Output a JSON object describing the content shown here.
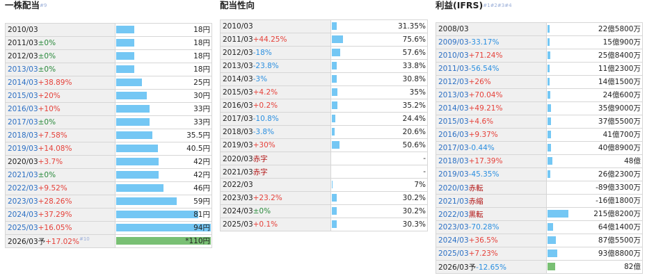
{
  "panels": [
    {
      "title": "一株配当",
      "note": "#9",
      "rows": [
        {
          "year": "2010/03",
          "link": false,
          "change": "",
          "cls": "",
          "value": "18円",
          "bar": 0.19
        },
        {
          "year": "2011/03",
          "link": false,
          "change": "±0%",
          "cls": "zero",
          "value": "18円",
          "bar": 0.19
        },
        {
          "year": "2012/03",
          "link": false,
          "change": "±0%",
          "cls": "zero",
          "value": "18円",
          "bar": 0.19
        },
        {
          "year": "2013/03",
          "link": true,
          "change": "±0%",
          "cls": "zero",
          "value": "18円",
          "bar": 0.19
        },
        {
          "year": "2014/03",
          "link": true,
          "change": "+38.89%",
          "cls": "pos",
          "value": "25円",
          "bar": 0.27
        },
        {
          "year": "2015/03",
          "link": true,
          "change": "+20%",
          "cls": "pos",
          "value": "30円",
          "bar": 0.32
        },
        {
          "year": "2016/03",
          "link": true,
          "change": "+10%",
          "cls": "pos",
          "value": "33円",
          "bar": 0.35
        },
        {
          "year": "2017/03",
          "link": true,
          "change": "±0%",
          "cls": "zero",
          "value": "33円",
          "bar": 0.35
        },
        {
          "year": "2018/03",
          "link": true,
          "change": "+7.58%",
          "cls": "pos",
          "value": "35.5円",
          "bar": 0.38
        },
        {
          "year": "2019/03",
          "link": true,
          "change": "+14.08%",
          "cls": "pos",
          "value": "40.5円",
          "bar": 0.44
        },
        {
          "year": "2020/03",
          "link": false,
          "change": "+3.7%",
          "cls": "pos",
          "value": "42円",
          "bar": 0.45
        },
        {
          "year": "2021/03",
          "link": true,
          "change": "±0%",
          "cls": "zero",
          "value": "42円",
          "bar": 0.45
        },
        {
          "year": "2022/03",
          "link": true,
          "change": "+9.52%",
          "cls": "pos",
          "value": "46円",
          "bar": 0.5
        },
        {
          "year": "2023/03",
          "link": true,
          "change": "+28.26%",
          "cls": "pos",
          "value": "59円",
          "bar": 0.64
        },
        {
          "year": "2024/03",
          "link": true,
          "change": "+37.29%",
          "cls": "pos",
          "value": "81円",
          "bar": 0.87
        },
        {
          "year": "2025/03",
          "link": true,
          "change": "+16.05%",
          "cls": "pos",
          "value": "94円",
          "bar": 1.0
        },
        {
          "year": "2026/03予",
          "link": false,
          "change": "+17.02%",
          "cls": "pos",
          "value": "*110円",
          "bar": 1.0,
          "green": true,
          "note": "#10"
        }
      ]
    },
    {
      "title": "配当性向",
      "note": "",
      "rows": [
        {
          "year": "2010/03",
          "link": false,
          "change": "",
          "cls": "",
          "value": "31.35%",
          "bar": 0.05
        },
        {
          "year": "2011/03",
          "link": false,
          "change": "+44.25%",
          "cls": "pos",
          "value": "75.6%",
          "bar": 0.12
        },
        {
          "year": "2012/03",
          "link": false,
          "change": "-18%",
          "cls": "neg",
          "value": "57.6%",
          "bar": 0.09
        },
        {
          "year": "2013/03",
          "link": false,
          "change": "-23.8%",
          "cls": "neg",
          "value": "33.8%",
          "bar": 0.05
        },
        {
          "year": "2014/03",
          "link": false,
          "change": "-3%",
          "cls": "neg",
          "value": "30.8%",
          "bar": 0.05
        },
        {
          "year": "2015/03",
          "link": false,
          "change": "+4.2%",
          "cls": "pos",
          "value": "35%",
          "bar": 0.06
        },
        {
          "year": "2016/03",
          "link": false,
          "change": "+0.2%",
          "cls": "pos",
          "value": "35.2%",
          "bar": 0.06
        },
        {
          "year": "2017/03",
          "link": false,
          "change": "-10.8%",
          "cls": "neg",
          "value": "24.4%",
          "bar": 0.04
        },
        {
          "year": "2018/03",
          "link": false,
          "change": "-3.8%",
          "cls": "neg",
          "value": "20.6%",
          "bar": 0.03
        },
        {
          "year": "2019/03",
          "link": false,
          "change": "+30%",
          "cls": "pos",
          "value": "50.6%",
          "bar": 0.08
        },
        {
          "year": "2020/03",
          "link": false,
          "change": "赤字",
          "cls": "dark",
          "value": "-",
          "bar": 0
        },
        {
          "year": "2021/03",
          "link": false,
          "change": "赤字",
          "cls": "dark",
          "value": "-",
          "bar": 0
        },
        {
          "year": "2022/03",
          "link": false,
          "change": "",
          "cls": "",
          "value": "7%",
          "bar": 0.01
        },
        {
          "year": "2023/03",
          "link": false,
          "change": "+23.2%",
          "cls": "pos",
          "value": "30.2%",
          "bar": 0.05
        },
        {
          "year": "2024/03",
          "link": false,
          "change": "±0%",
          "cls": "zero",
          "value": "30.2%",
          "bar": 0.05
        },
        {
          "year": "2025/03",
          "link": false,
          "change": "+0.1%",
          "cls": "pos",
          "value": "30.3%",
          "bar": 0.05
        }
      ]
    },
    {
      "title": "利益(IFRS)",
      "note": "#1#2#3#4",
      "rows": [
        {
          "year": "2008/03",
          "link": false,
          "change": "",
          "cls": "",
          "value": "22億5800万",
          "bar": 0.02
        },
        {
          "year": "2009/03",
          "link": true,
          "change": "-33.17%",
          "cls": "neg",
          "value": "15億900万",
          "bar": 0.02
        },
        {
          "year": "2010/03",
          "link": true,
          "change": "+71.24%",
          "cls": "pos",
          "value": "25億8400万",
          "bar": 0.03
        },
        {
          "year": "2011/03",
          "link": true,
          "change": "-56.54%",
          "cls": "neg",
          "value": "11億2300万",
          "bar": 0.02
        },
        {
          "year": "2012/03",
          "link": true,
          "change": "+26%",
          "cls": "pos",
          "value": "14億1500万",
          "bar": 0.02
        },
        {
          "year": "2013/03",
          "link": true,
          "change": "+70.04%",
          "cls": "pos",
          "value": "24億600万",
          "bar": 0.03
        },
        {
          "year": "2014/03",
          "link": true,
          "change": "+49.21%",
          "cls": "pos",
          "value": "35億9000万",
          "bar": 0.04
        },
        {
          "year": "2015/03",
          "link": true,
          "change": "+4.6%",
          "cls": "pos",
          "value": "37億5500万",
          "bar": 0.04
        },
        {
          "year": "2016/03",
          "link": true,
          "change": "+9.37%",
          "cls": "pos",
          "value": "41億700万",
          "bar": 0.04
        },
        {
          "year": "2017/03",
          "link": true,
          "change": "-0.44%",
          "cls": "neg",
          "value": "40億8900万",
          "bar": 0.04
        },
        {
          "year": "2018/03",
          "link": true,
          "change": "+17.39%",
          "cls": "pos",
          "value": "48億",
          "bar": 0.05
        },
        {
          "year": "2019/03",
          "link": true,
          "change": "-45.35%",
          "cls": "neg",
          "value": "26億2300万",
          "bar": 0.03
        },
        {
          "year": "2020/03",
          "link": true,
          "change": "赤転",
          "cls": "dark",
          "value": "-89億3300万",
          "bar": 0
        },
        {
          "year": "2021/03",
          "link": true,
          "change": "赤縮",
          "cls": "dark",
          "value": "-16億1800万",
          "bar": 0
        },
        {
          "year": "2022/03",
          "link": true,
          "change": "黒転",
          "cls": "dark",
          "value": "215億8200万",
          "bar": 0.22
        },
        {
          "year": "2023/03",
          "link": true,
          "change": "-70.28%",
          "cls": "neg",
          "value": "64億1400万",
          "bar": 0.06
        },
        {
          "year": "2024/03",
          "link": true,
          "change": "+36.5%",
          "cls": "pos",
          "value": "87億5500万",
          "bar": 0.09
        },
        {
          "year": "2025/03",
          "link": true,
          "change": "+7.23%",
          "cls": "pos",
          "value": "93億8800万",
          "bar": 0.1
        },
        {
          "year": "2026/03予",
          "link": false,
          "change": "-12.65%",
          "cls": "neg",
          "value": "82億",
          "bar": 0.08,
          "green": true
        }
      ]
    }
  ]
}
